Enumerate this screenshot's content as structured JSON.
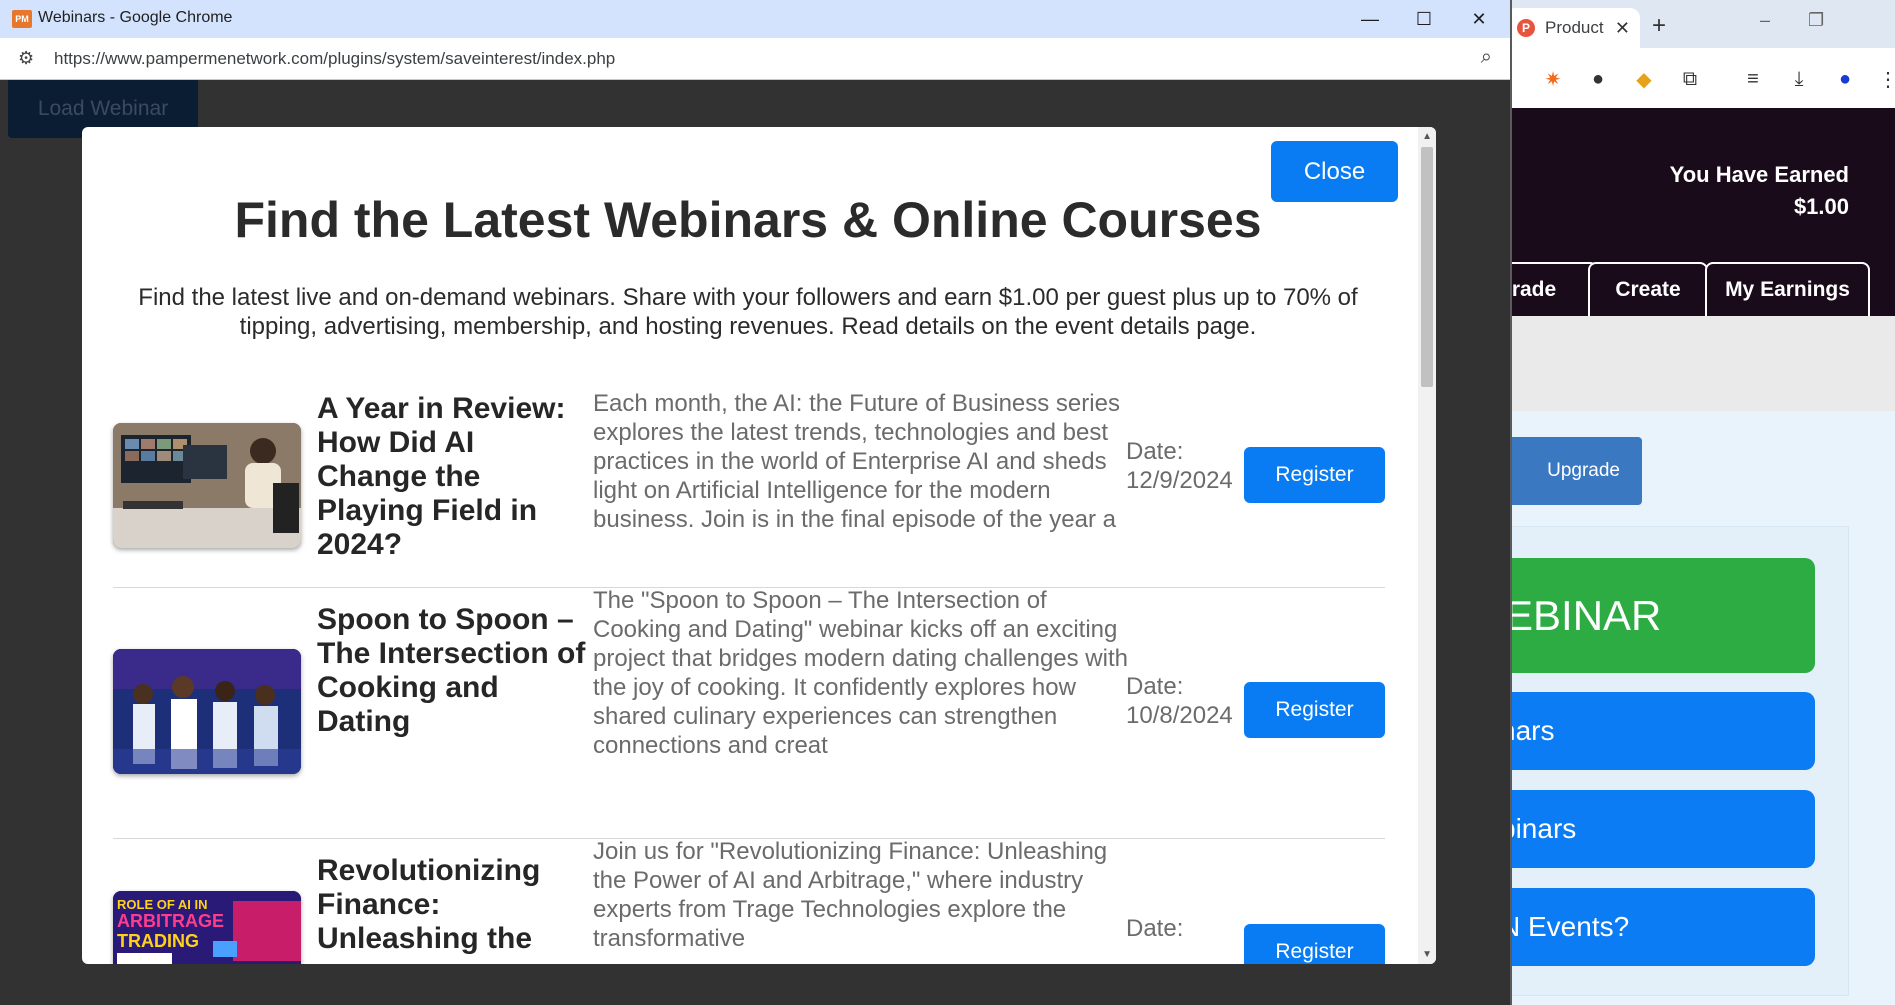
{
  "background_browser": {
    "tab_title": "Product",
    "header": {
      "earned_label": "You Have Earned",
      "earned_value": "$1.00",
      "nav_tabs": [
        "rade",
        "Create",
        "My Earnings"
      ]
    },
    "upgrade_label": "Upgrade",
    "buttons": [
      "EBINAR",
      "nars",
      "binars",
      "N Events?"
    ]
  },
  "popup": {
    "window_title": "Webinars - Google Chrome",
    "url": "https://www.pampermenetwork.com/plugins/system/saveinterest/index.php",
    "load_button": "Load Webinar"
  },
  "modal": {
    "close_label": "Close",
    "heading": "Find the Latest Webinars & Online Courses",
    "intro": "Find the latest live and on-demand webinars. Share with your followers and earn $1.00 per guest plus up to 70% of tipping, advertising, membership, and hosting revenues. Read details on the event details page.",
    "webinars": [
      {
        "title": "A Year in Review: How Did AI Change the Playing Field in 2024?",
        "description": "Each month, the AI: the Future of Business series explores the latest trends, technologies and best practices in the world of Enterprise AI and sheds light on Artificial Intelligence for the modern business. Join is in the final episode of the year a",
        "date_label": "Date:",
        "date": "12/9/2024",
        "button": "Register"
      },
      {
        "title": "Spoon to Spoon – The Intersection of Cooking and Dating",
        "description": "The \"Spoon to Spoon – The Intersection of Cooking and Dating\" webinar kicks off an exciting project that bridges modern dating challenges with the joy of cooking. It confidently explores how shared culinary experiences can strengthen connections and creat",
        "date_label": "Date:",
        "date": "10/8/2024",
        "button": "Register"
      },
      {
        "title": "Revolutionizing Finance: Unleashing the",
        "description": "Join us for \"Revolutionizing Finance: Unleashing the Power of AI and Arbitrage,\" where industry experts from Trage Technologies explore the transformative",
        "date_label": "Date:",
        "date": "",
        "button": "Register",
        "thumb_text": "ROLE OF AI IN ARBITRAGE TRADING"
      }
    ]
  },
  "colors": {
    "primary_blue": "#0a7cf3",
    "green": "#2eac44",
    "header_dark": "#1a0b1b"
  }
}
